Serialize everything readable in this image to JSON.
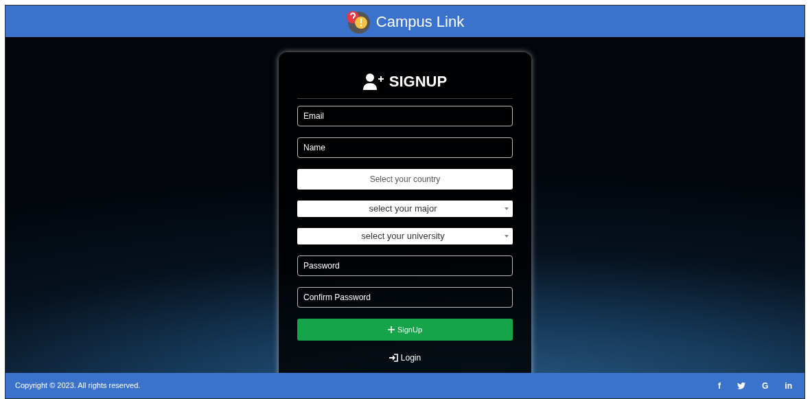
{
  "header": {
    "title": "Campus Link"
  },
  "form": {
    "title": "SIGNUP",
    "fields": [
      {
        "kind": "text",
        "placeholder": "Email"
      },
      {
        "kind": "text",
        "placeholder": "Name"
      },
      {
        "kind": "picker",
        "placeholder": "Select your country"
      },
      {
        "kind": "select",
        "value": "select your major"
      },
      {
        "kind": "select",
        "value": "select your university"
      },
      {
        "kind": "text",
        "placeholder": "Password"
      },
      {
        "kind": "text",
        "placeholder": "Confirm Password"
      }
    ],
    "submit": "SignUp",
    "login": "Login"
  },
  "footer": {
    "copyright": "Copyright © 2023. All rights reserved.",
    "social": [
      {
        "kind": "text",
        "label": "f"
      },
      {
        "kind": "bird"
      },
      {
        "kind": "text",
        "label": "G"
      },
      {
        "kind": "text",
        "label": "in"
      }
    ]
  }
}
